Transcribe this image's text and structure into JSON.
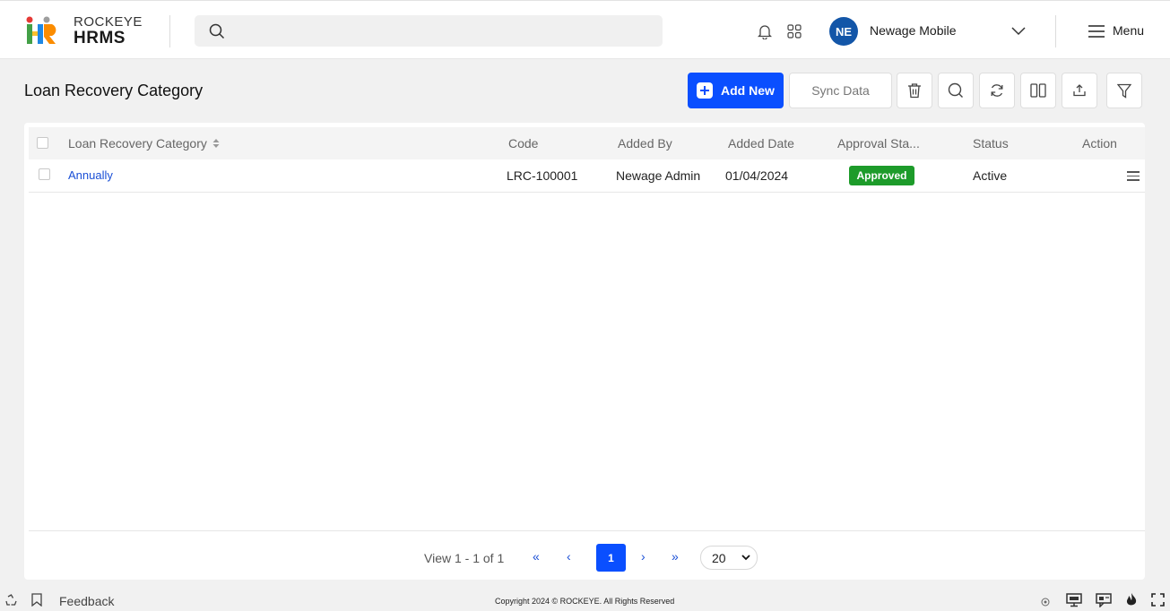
{
  "header": {
    "brand_top": "ROCKEYE",
    "brand_bottom": "HRMS",
    "search_placeholder": "",
    "user_initials": "NE",
    "user_name": "Newage Mobile",
    "menu_label": "Menu"
  },
  "toolbar": {
    "page_title": "Loan Recovery Category",
    "add_label": "Add New",
    "sync_label": "Sync Data",
    "icons": [
      "delete-icon",
      "search-icon",
      "refresh-icon",
      "columns-icon",
      "export-icon",
      "filter-icon"
    ]
  },
  "table": {
    "columns": [
      "Loan Recovery Category",
      "Code",
      "Added By",
      "Added Date",
      "Approval Sta...",
      "Status",
      "Action"
    ],
    "rows": [
      {
        "category": "Annually",
        "code": "LRC-100001",
        "added_by": "Newage Admin",
        "added_date": "01/04/2024",
        "approval": "Approved",
        "status": "Active"
      }
    ]
  },
  "pagination": {
    "view_text": "View 1 - 1 of 1",
    "first": "«",
    "prev": "‹",
    "current_page": "1",
    "next": "›",
    "last": "»",
    "page_size": "20"
  },
  "footer": {
    "feedback": "Feedback",
    "copyright": "Copyright 2024 © ROCKEYE. All Rights Reserved"
  },
  "colors": {
    "primary": "#0a4fff",
    "approved": "#1d9b2a",
    "avatar": "#1356a8",
    "link": "#1a4fd6"
  }
}
